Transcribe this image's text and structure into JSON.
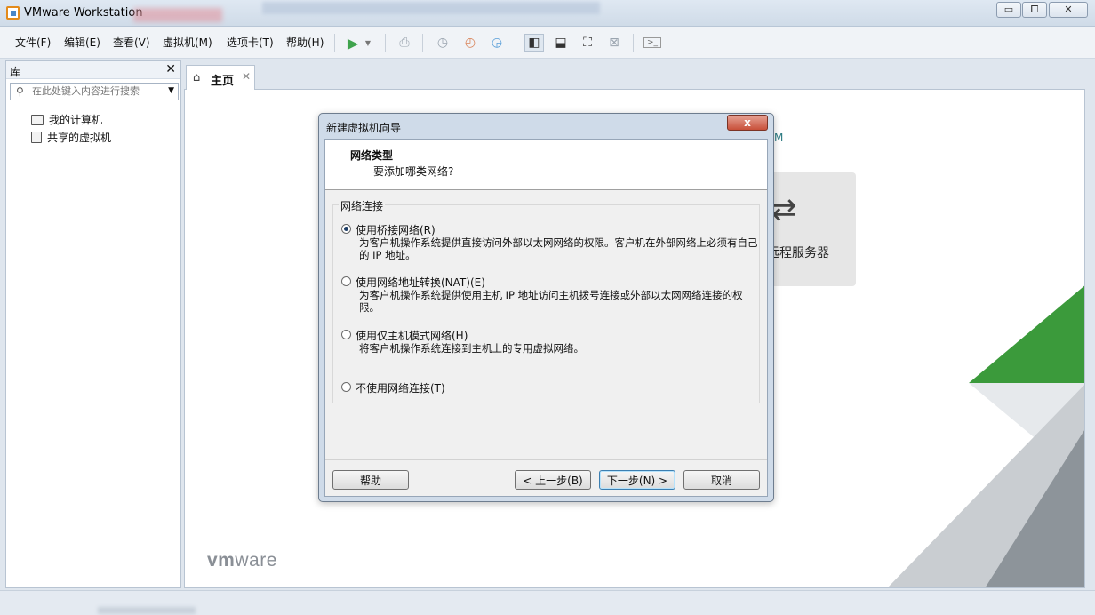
{
  "window": {
    "title": "VMware Workstation",
    "controls": {
      "minimize": "▭",
      "maximize": "⧠",
      "close": "✕"
    }
  },
  "menu": {
    "items": [
      "文件(F)",
      "编辑(E)",
      "查看(V)",
      "虚拟机(M)",
      "选项卡(T)",
      "帮助(H)"
    ]
  },
  "toolbar": {
    "icons": [
      "play-icon",
      "send-keys-icon",
      "snapshot-icon",
      "revert-snapshot-icon",
      "snapshot-manager-icon",
      "library-view-icon",
      "console-view-icon",
      "fullscreen-icon",
      "unity-icon",
      "terminal-icon"
    ]
  },
  "library": {
    "title": "库",
    "close": "✕",
    "search_placeholder": "在此处键入内容进行搜索",
    "items": [
      "我的计算机",
      "共享的虚拟机"
    ]
  },
  "tabs": [
    {
      "label": "主页",
      "close": "✕"
    }
  ],
  "home": {
    "heading_suffix": "M",
    "remote_server_label": "远程服务器",
    "remote_icon": "⇄",
    "logo_prefix": "vm",
    "logo_suffix": "ware"
  },
  "dialog": {
    "title": "新建虚拟机向导",
    "close": "x",
    "header_title": "网络类型",
    "header_subtitle": "要添加哪类网络?",
    "group_title": "网络连接",
    "options": [
      {
        "label": "使用桥接网络(R)",
        "desc": "为客户机操作系统提供直接访问外部以太网网络的权限。客户机在外部网络上必须有自己的 IP 地址。",
        "checked": true
      },
      {
        "label": "使用网络地址转换(NAT)(E)",
        "desc": "为客户机操作系统提供使用主机 IP 地址访问主机拨号连接或外部以太网网络连接的权限。",
        "checked": false
      },
      {
        "label": "使用仅主机模式网络(H)",
        "desc": "将客户机操作系统连接到主机上的专用虚拟网络。",
        "checked": false
      },
      {
        "label": "不使用网络连接(T)",
        "desc": "",
        "checked": false
      }
    ],
    "buttons": {
      "help": "帮助",
      "back": "< 上一步(B)",
      "next": "下一步(N) >",
      "cancel": "取消"
    }
  },
  "colors": {
    "accent_green": "#3b9a3b",
    "gray_triangle": "#c9cdd1",
    "dark_gray_triangle": "#8d949a"
  }
}
